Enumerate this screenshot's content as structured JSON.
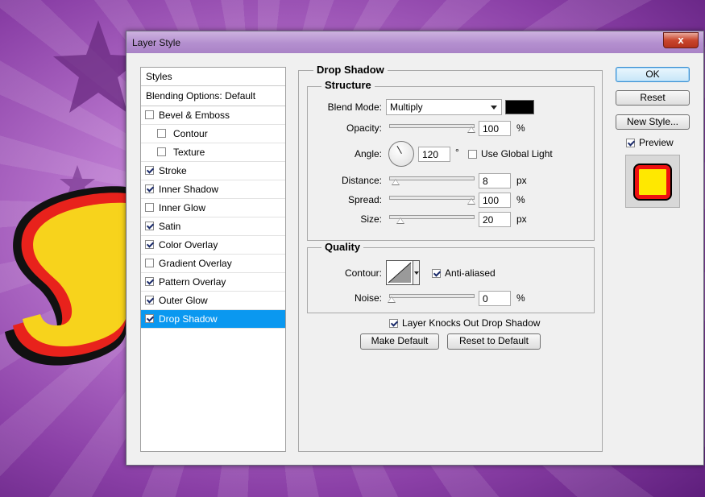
{
  "window": {
    "title": "Layer Style",
    "close_label": "x"
  },
  "styles_panel": {
    "header": "Styles",
    "blending_options": "Blending Options: Default",
    "items": [
      {
        "label": "Bevel & Emboss",
        "checked": false,
        "sub": false
      },
      {
        "label": "Contour",
        "checked": false,
        "sub": true
      },
      {
        "label": "Texture",
        "checked": false,
        "sub": true
      },
      {
        "label": "Stroke",
        "checked": true,
        "sub": false
      },
      {
        "label": "Inner Shadow",
        "checked": true,
        "sub": false
      },
      {
        "label": "Inner Glow",
        "checked": false,
        "sub": false
      },
      {
        "label": "Satin",
        "checked": true,
        "sub": false
      },
      {
        "label": "Color Overlay",
        "checked": true,
        "sub": false
      },
      {
        "label": "Gradient Overlay",
        "checked": false,
        "sub": false
      },
      {
        "label": "Pattern Overlay",
        "checked": true,
        "sub": false
      },
      {
        "label": "Outer Glow",
        "checked": true,
        "sub": false
      },
      {
        "label": "Drop Shadow",
        "checked": true,
        "sub": false,
        "selected": true
      }
    ]
  },
  "drop_shadow": {
    "title": "Drop Shadow",
    "structure": {
      "title": "Structure",
      "blend_mode_label": "Blend Mode:",
      "blend_mode_value": "Multiply",
      "shadow_color": "#000000",
      "opacity_label": "Opacity:",
      "opacity_value": "100",
      "opacity_unit": "%",
      "angle_label": "Angle:",
      "angle_value": "120",
      "angle_unit": "°",
      "global_light_label": "Use Global Light",
      "global_light_checked": false,
      "distance_label": "Distance:",
      "distance_value": "8",
      "distance_unit": "px",
      "spread_label": "Spread:",
      "spread_value": "100",
      "spread_unit": "%",
      "size_label": "Size:",
      "size_value": "20",
      "size_unit": "px"
    },
    "quality": {
      "title": "Quality",
      "contour_label": "Contour:",
      "anti_aliased_label": "Anti-aliased",
      "anti_aliased_checked": true,
      "noise_label": "Noise:",
      "noise_value": "0",
      "noise_unit": "%"
    },
    "knockout_label": "Layer Knocks Out Drop Shadow",
    "knockout_checked": true,
    "make_default_label": "Make Default",
    "reset_default_label": "Reset to Default"
  },
  "buttons": {
    "ok": "OK",
    "reset": "Reset",
    "new_style": "New Style...",
    "preview_label": "Preview",
    "preview_checked": true
  },
  "colors": {
    "selected_row": "#0a98f0",
    "preview_fill": "#ffe800",
    "preview_stroke": "#ee1111"
  }
}
